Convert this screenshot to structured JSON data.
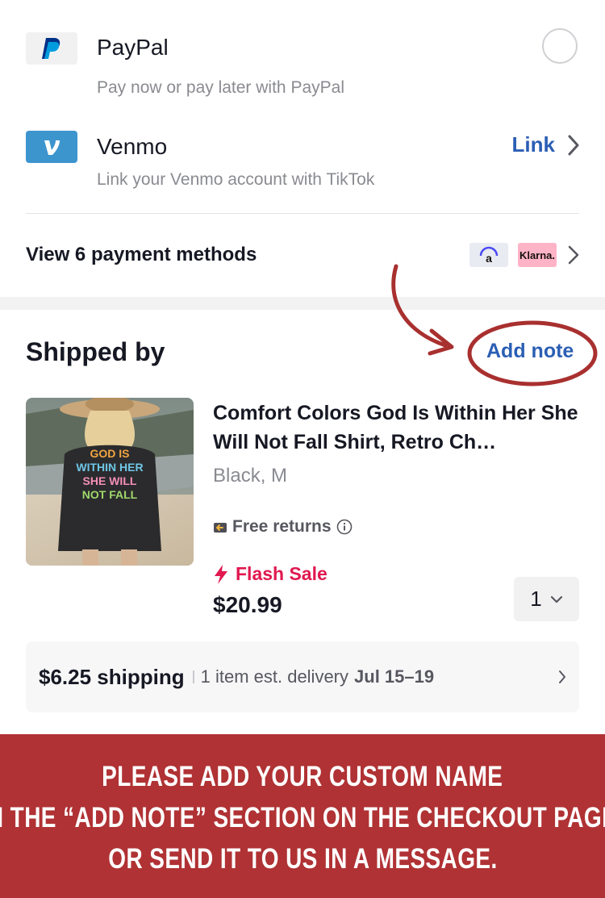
{
  "payment_methods": [
    {
      "name": "PayPal",
      "subtitle": "Pay now or pay later with PayPal",
      "logo_icon": "paypal-logo",
      "control": "radio",
      "selected": false
    },
    {
      "name": "Venmo",
      "subtitle": "Link your Venmo account with TikTok",
      "logo_icon": "venmo-logo",
      "action_label": "Link"
    }
  ],
  "view_methods": {
    "label": "View 6 payment methods",
    "badges": [
      "affirm-logo",
      "Klarna."
    ]
  },
  "shipped": {
    "title": "Shipped by",
    "add_note": "Add note"
  },
  "product": {
    "title": "Comfort Colors God Is Within Her She Will Not Fall Shirt, Retro Ch…",
    "variant": "Black, M",
    "free_returns": "Free returns",
    "flash_sale": "Flash Sale",
    "price": "$20.99",
    "quantity": "1",
    "image_text": [
      "GOD IS",
      "WITHIN HER",
      "SHE WILL",
      "NOT FALL"
    ]
  },
  "shipping": {
    "price": "$6.25 shipping",
    "est": "1 item est. delivery",
    "date": "Jul 15–19"
  },
  "banner": {
    "lines": [
      "Please add your custom name",
      "in the “add note” section on the checkout page,",
      "or send it to us in a message."
    ]
  },
  "colors": {
    "link_blue": "#2b5fb4",
    "flash_red": "#e0194f",
    "annotation_red": "#a8302f",
    "banner_red": "#b03234"
  }
}
